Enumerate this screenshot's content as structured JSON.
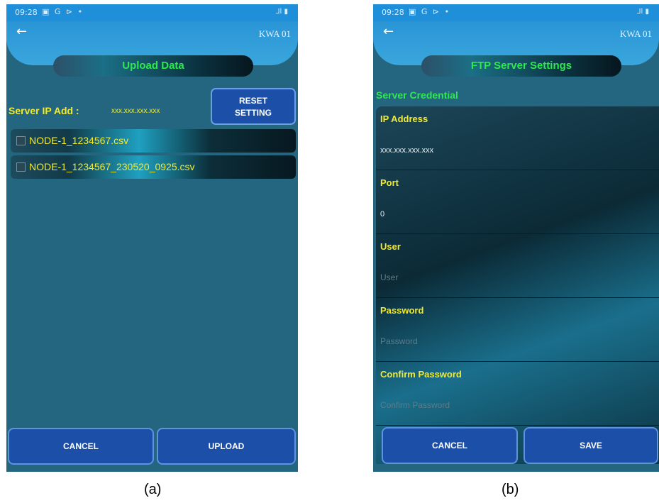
{
  "screen_a": {
    "status_time": "09:28",
    "status_notif": "▣ G ⊳ •",
    "status_sys": "⅃l ▮",
    "back_glyph": "←",
    "device_id": "KWA 01",
    "title": "Upload Data",
    "server_ip_label": "Server IP Add :",
    "server_ip_value": "xxx.xxx.xxx.xxx",
    "reset_button_line1": "RESET",
    "reset_button_line2": "SETTING",
    "files": [
      {
        "name": "NODE-1_1234567.csv",
        "checked": false
      },
      {
        "name": "NODE-1_1234567_230520_0925.csv",
        "checked": false
      }
    ],
    "cancel_label": "CANCEL",
    "upload_label": "UPLOAD"
  },
  "screen_b": {
    "status_time": "09:28",
    "status_notif": "▣ G ⊳ •",
    "status_sys": "⅃l ▮",
    "back_glyph": "←",
    "device_id": "KWA 01",
    "title": "FTP Server Settings",
    "section_label": "Server Credential",
    "fields": {
      "ip_label": "IP Address",
      "ip_value": "xxx.xxx.xxx.xxx",
      "port_label": "Port",
      "port_value": "0",
      "user_label": "User",
      "user_placeholder": "User",
      "password_label": "Password",
      "password_placeholder": "Password",
      "confirm_label": "Confirm Password",
      "confirm_placeholder": "Confirm Password"
    },
    "cancel_label": "CANCEL",
    "save_label": "SAVE"
  },
  "captions": {
    "a": "(a)",
    "b": "(b)"
  },
  "colors": {
    "background": "#24667f",
    "header": "#2a95d6",
    "accent_green": "#2ee84f",
    "text_yellow": "#f2ea2c",
    "button_blue": "#1c4fa8"
  }
}
